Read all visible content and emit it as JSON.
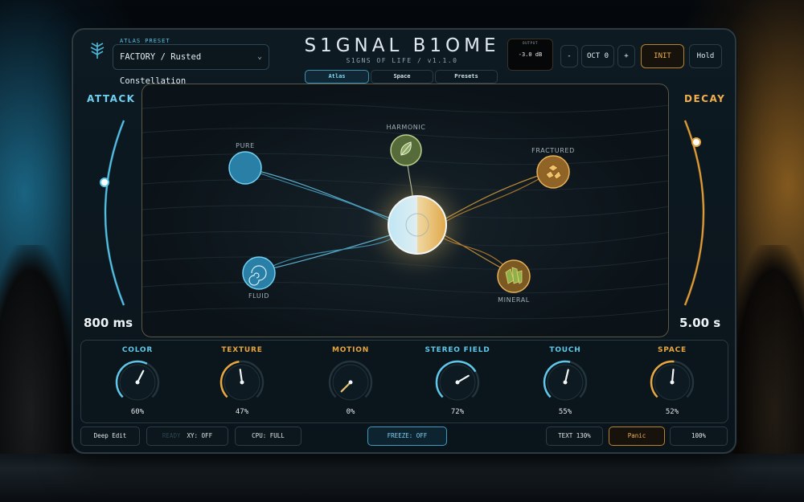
{
  "header": {
    "preset_label": "ATLAS PRESET",
    "preset_value": "FACTORY / Rusted Constellation",
    "title": "S1GNAL B1OME",
    "subtitle": "S1GNS OF LIFE  /  v1.1.0",
    "tabs": [
      {
        "label": "Atlas",
        "active": true
      },
      {
        "label": "Space",
        "active": false
      },
      {
        "label": "Presets",
        "active": false
      }
    ],
    "output_label": "OUTPUT",
    "output_value": "-3.0 dB",
    "oct_minus": "-",
    "oct_value": "OCT 0",
    "oct_plus": "+",
    "init_label": "INIT",
    "hold_label": "Hold"
  },
  "attack": {
    "label": "ATTACK",
    "value": "800 ms",
    "level": 0.6
  },
  "decay": {
    "label": "DECAY",
    "value": "5.00 s",
    "level": 0.85
  },
  "atlas": {
    "nodes": [
      {
        "name": "PURE",
        "icon": "sphere-icon"
      },
      {
        "name": "HARMONIC",
        "icon": "leaf-icon"
      },
      {
        "name": "FRACTURED",
        "icon": "crystal-cluster-icon"
      },
      {
        "name": "FLUID",
        "icon": "swirl-icon"
      },
      {
        "name": "MINERAL",
        "icon": "gem-icon"
      }
    ]
  },
  "knobs": [
    {
      "label": "COLOR",
      "value": "60%",
      "level": 0.6,
      "accent": "#5fc8ea"
    },
    {
      "label": "TEXTURE",
      "value": "47%",
      "level": 0.47,
      "accent": "#e8a640"
    },
    {
      "label": "MOTION",
      "value": "0%",
      "level": 0.0,
      "accent": "#e8a640"
    },
    {
      "label": "STEREO FIELD",
      "value": "72%",
      "level": 0.72,
      "accent": "#5fc8ea"
    },
    {
      "label": "TOUCH",
      "value": "55%",
      "level": 0.55,
      "accent": "#5fc8ea"
    },
    {
      "label": "SPACE",
      "value": "52%",
      "level": 0.52,
      "accent": "#e8a640"
    }
  ],
  "footer": {
    "deep_edit": "Deep Edit",
    "ready": "READY",
    "xy": "XY: OFF",
    "cpu": "CPU: FULL",
    "freeze": "FREEZE: OFF",
    "text_size": "TEXT 130%",
    "panic": "Panic",
    "zoom": "100%"
  },
  "colors": {
    "cool": "#5fc8ea",
    "warm": "#e8a640"
  }
}
